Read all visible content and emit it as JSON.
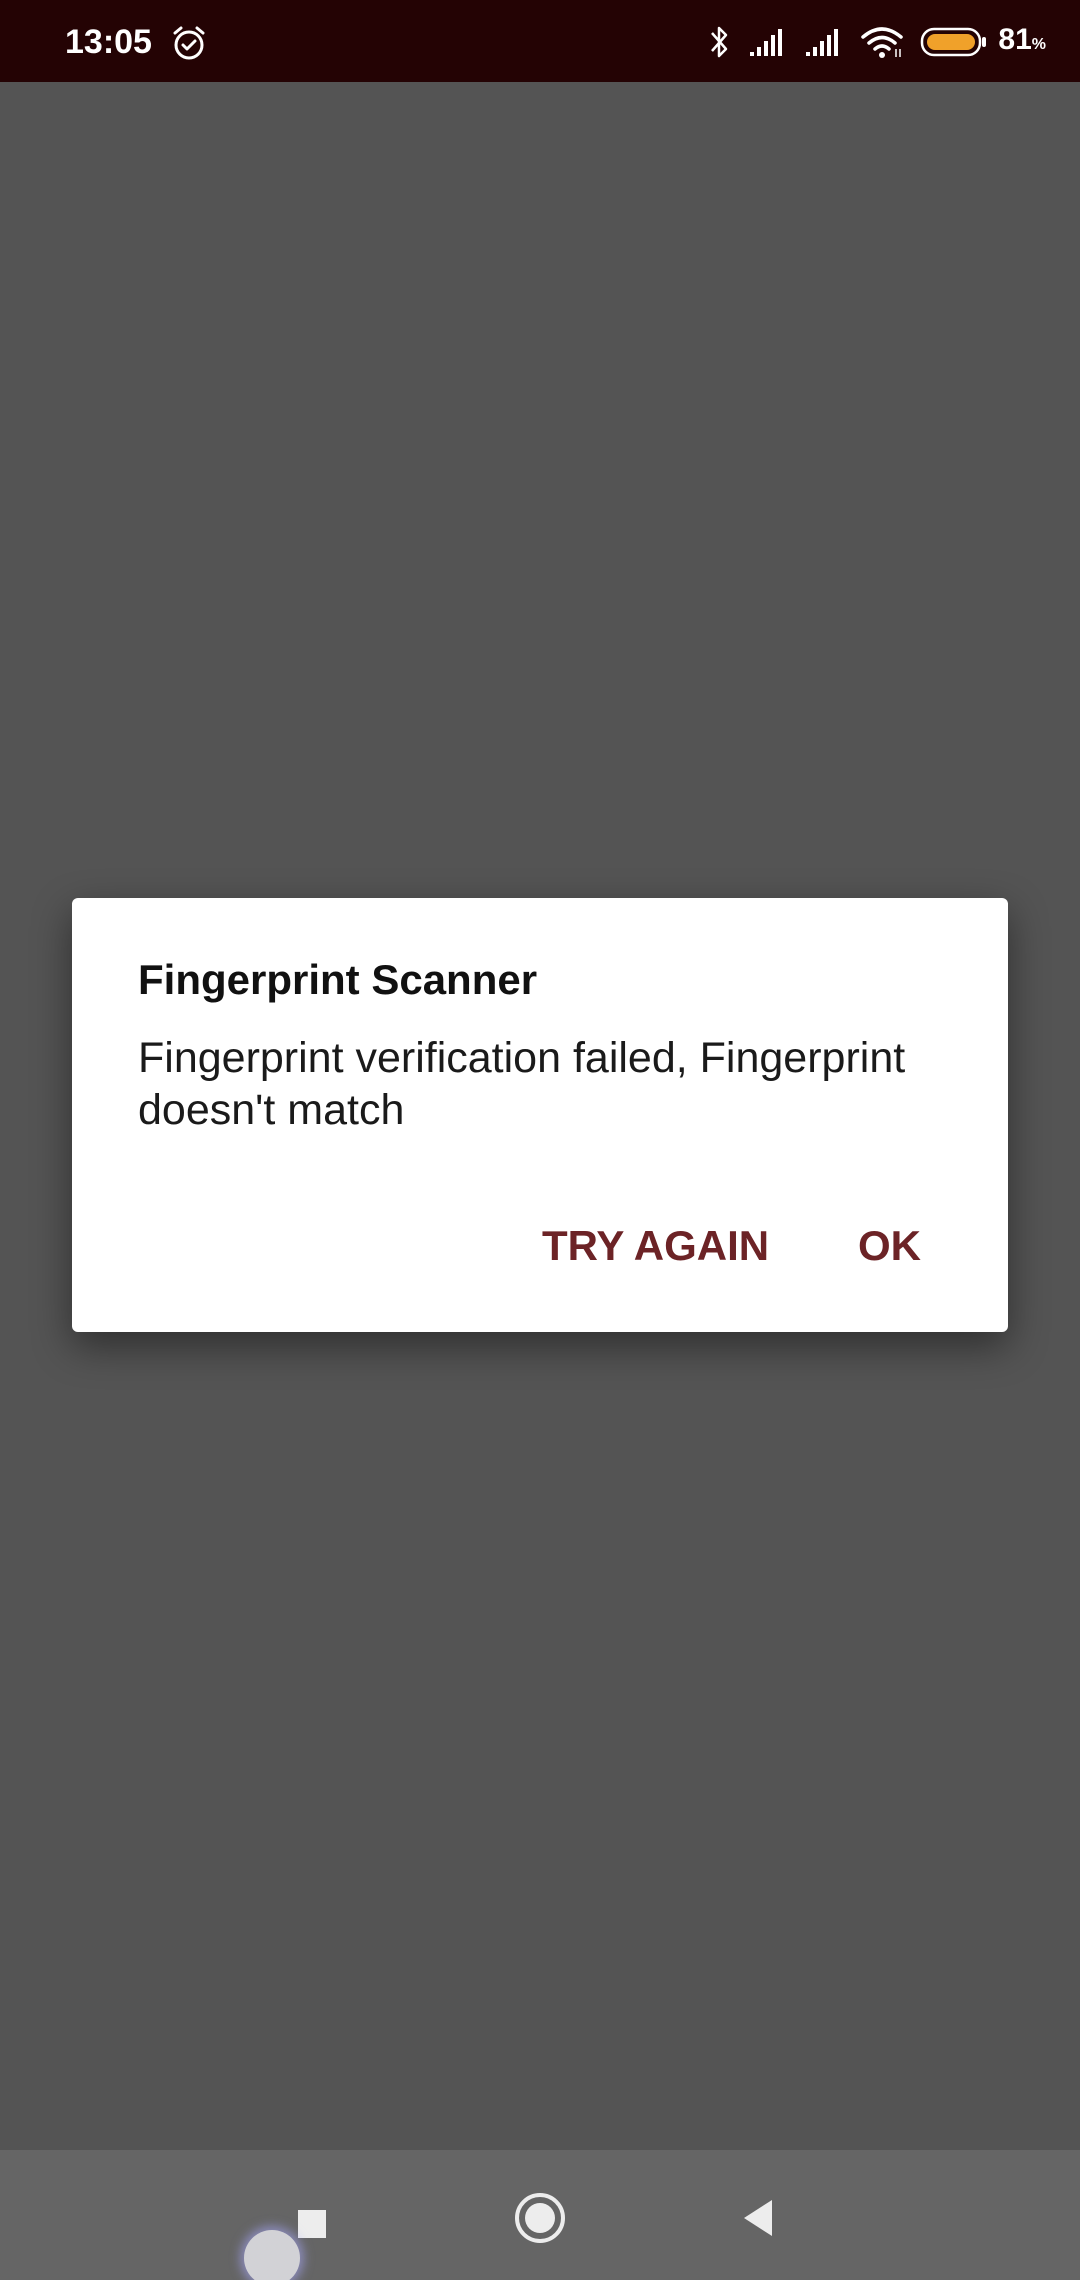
{
  "status_bar": {
    "time": "13:05",
    "battery_percent": "81",
    "battery_percent_sign": "%",
    "icons": [
      "alarm-icon",
      "bluetooth-icon",
      "signal-icon",
      "signal-icon",
      "wifi-icon",
      "battery-icon"
    ],
    "colors": {
      "background": "#240304",
      "battery_fill": "#f0a12a"
    }
  },
  "dialog": {
    "title": "Fingerprint Scanner",
    "message": "Fingerprint verification failed, Fingerprint doesn't match",
    "buttons": {
      "try_again": "TRY AGAIN",
      "ok": "OK"
    },
    "colors": {
      "button_text": "#6c2326",
      "background": "#ffffff"
    }
  },
  "nav_bar": {
    "items": [
      "recents-icon",
      "home-icon",
      "back-icon"
    ]
  },
  "colors": {
    "scrim": "#545454",
    "nav_background": "#656565"
  }
}
